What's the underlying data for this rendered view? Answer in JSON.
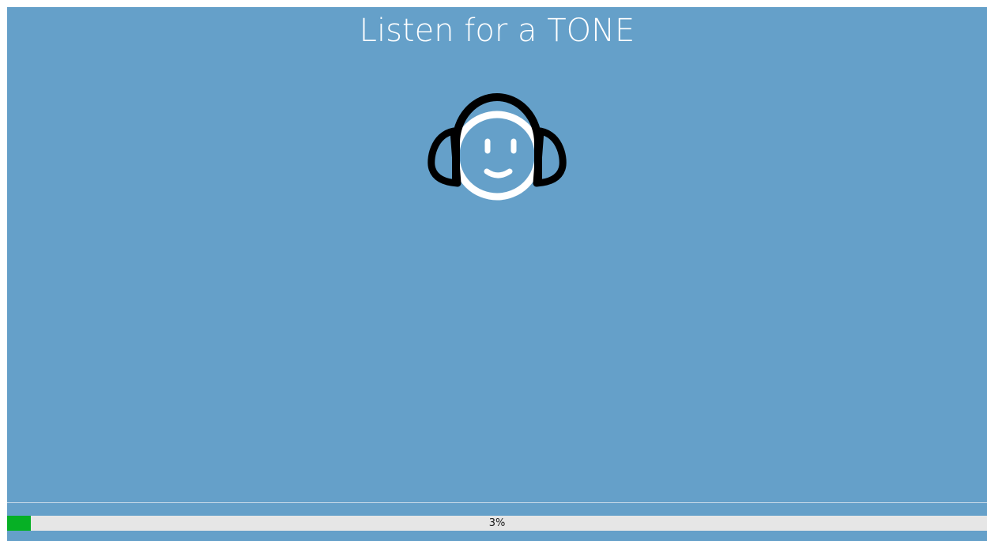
{
  "screen": {
    "title": "Listen for a TONE",
    "icon": "headphones-face-icon",
    "background_color": "#65a0c9"
  },
  "progress": {
    "value_percent": 3,
    "label": "3%",
    "fill_color": "#06b025",
    "track_color": "#e6e6e6"
  }
}
